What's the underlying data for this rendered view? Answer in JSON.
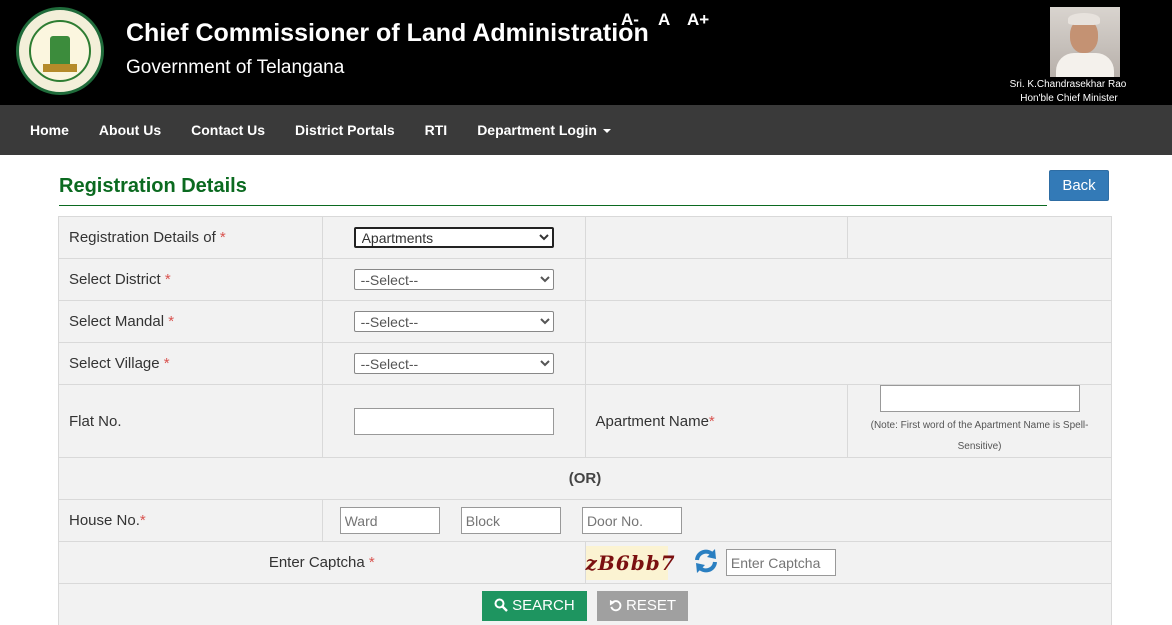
{
  "header": {
    "title": "Chief Commissioner of Land Administration",
    "subtitle": "Government of Telangana",
    "font_controls": [
      "A-",
      "A",
      "A+"
    ],
    "cm_name": "Sri. K.Chandrasekhar Rao",
    "cm_role": "Hon'ble Chief Minister"
  },
  "nav": {
    "items": [
      "Home",
      "About Us",
      "Contact Us",
      "District Portals",
      "RTI"
    ],
    "dropdown_label": "Department Login"
  },
  "page": {
    "title": "Registration Details",
    "back_label": "Back"
  },
  "form": {
    "registration_details_of": {
      "label": "Registration Details of",
      "value": "Apartments"
    },
    "district": {
      "label": "Select District",
      "value": "--Select--"
    },
    "mandal": {
      "label": "Select Mandal",
      "value": "--Select--"
    },
    "village": {
      "label": "Select Village",
      "value": "--Select--"
    },
    "flat_no": {
      "label": "Flat No.",
      "value": ""
    },
    "apartment_name": {
      "label": "Apartment Name",
      "value": "",
      "note": "(Note: First word of the Apartment Name is Spell-Sensitive)"
    },
    "or_text": "(OR)",
    "house_no": {
      "label": "House No.",
      "ward_placeholder": "Ward",
      "block_placeholder": "Block",
      "door_placeholder": "Door No."
    },
    "captcha": {
      "label": "Enter Captcha",
      "code": "zB6bb7",
      "placeholder": "Enter Captcha"
    },
    "search_label": "SEARCH",
    "reset_label": "RESET",
    "required_mark": "*"
  },
  "colors": {
    "header_bg": "#000000",
    "nav_bg": "#3a3a3a",
    "title_green": "#0b6a20",
    "back_blue": "#337ab7",
    "search_green": "#1e9560",
    "reset_grey": "#a0a0a0",
    "required_red": "#d9534f"
  }
}
